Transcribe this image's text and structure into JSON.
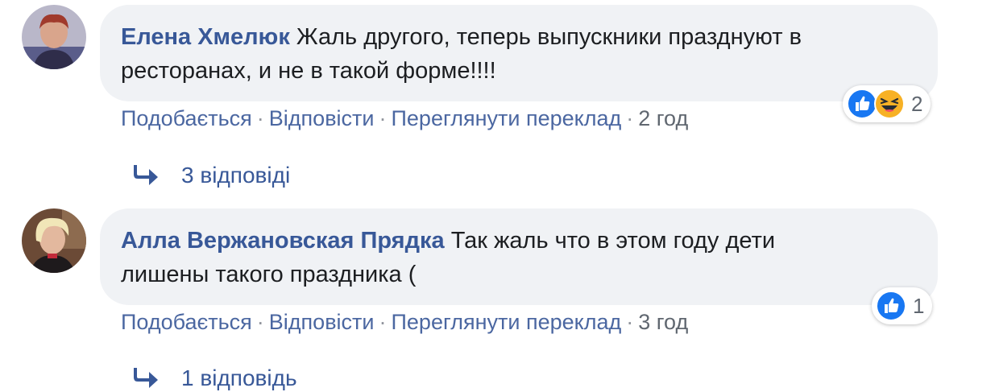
{
  "comments": [
    {
      "author": "Елена Хмелюк",
      "text_line1": "Жаль другого, теперь выпускники празднуют в",
      "text_line2": "ресторанах, и не в такой форме!!!!",
      "actions": {
        "like": "Подобається",
        "reply": "Відповісти",
        "translate": "Переглянути переклад",
        "time": "2 год"
      },
      "reactions": {
        "icons": [
          "like-icon",
          "haha-icon"
        ],
        "count": "2"
      },
      "replies": "3 відповіді"
    },
    {
      "author": "Алла Вержановская Прядка",
      "text_line1": "Так жаль что в этом году дети",
      "text_line2": "лишены такого праздника (",
      "actions": {
        "like": "Подобається",
        "reply": "Відповісти",
        "translate": "Переглянути переклад",
        "time": "3 год"
      },
      "reactions": {
        "icons": [
          "like-icon"
        ],
        "count": "1"
      },
      "replies": "1 відповідь"
    }
  ],
  "colors": {
    "link": "#385898",
    "bubble": "#f0f2f5",
    "like": "#1877f2",
    "haha": "#f7b125"
  }
}
